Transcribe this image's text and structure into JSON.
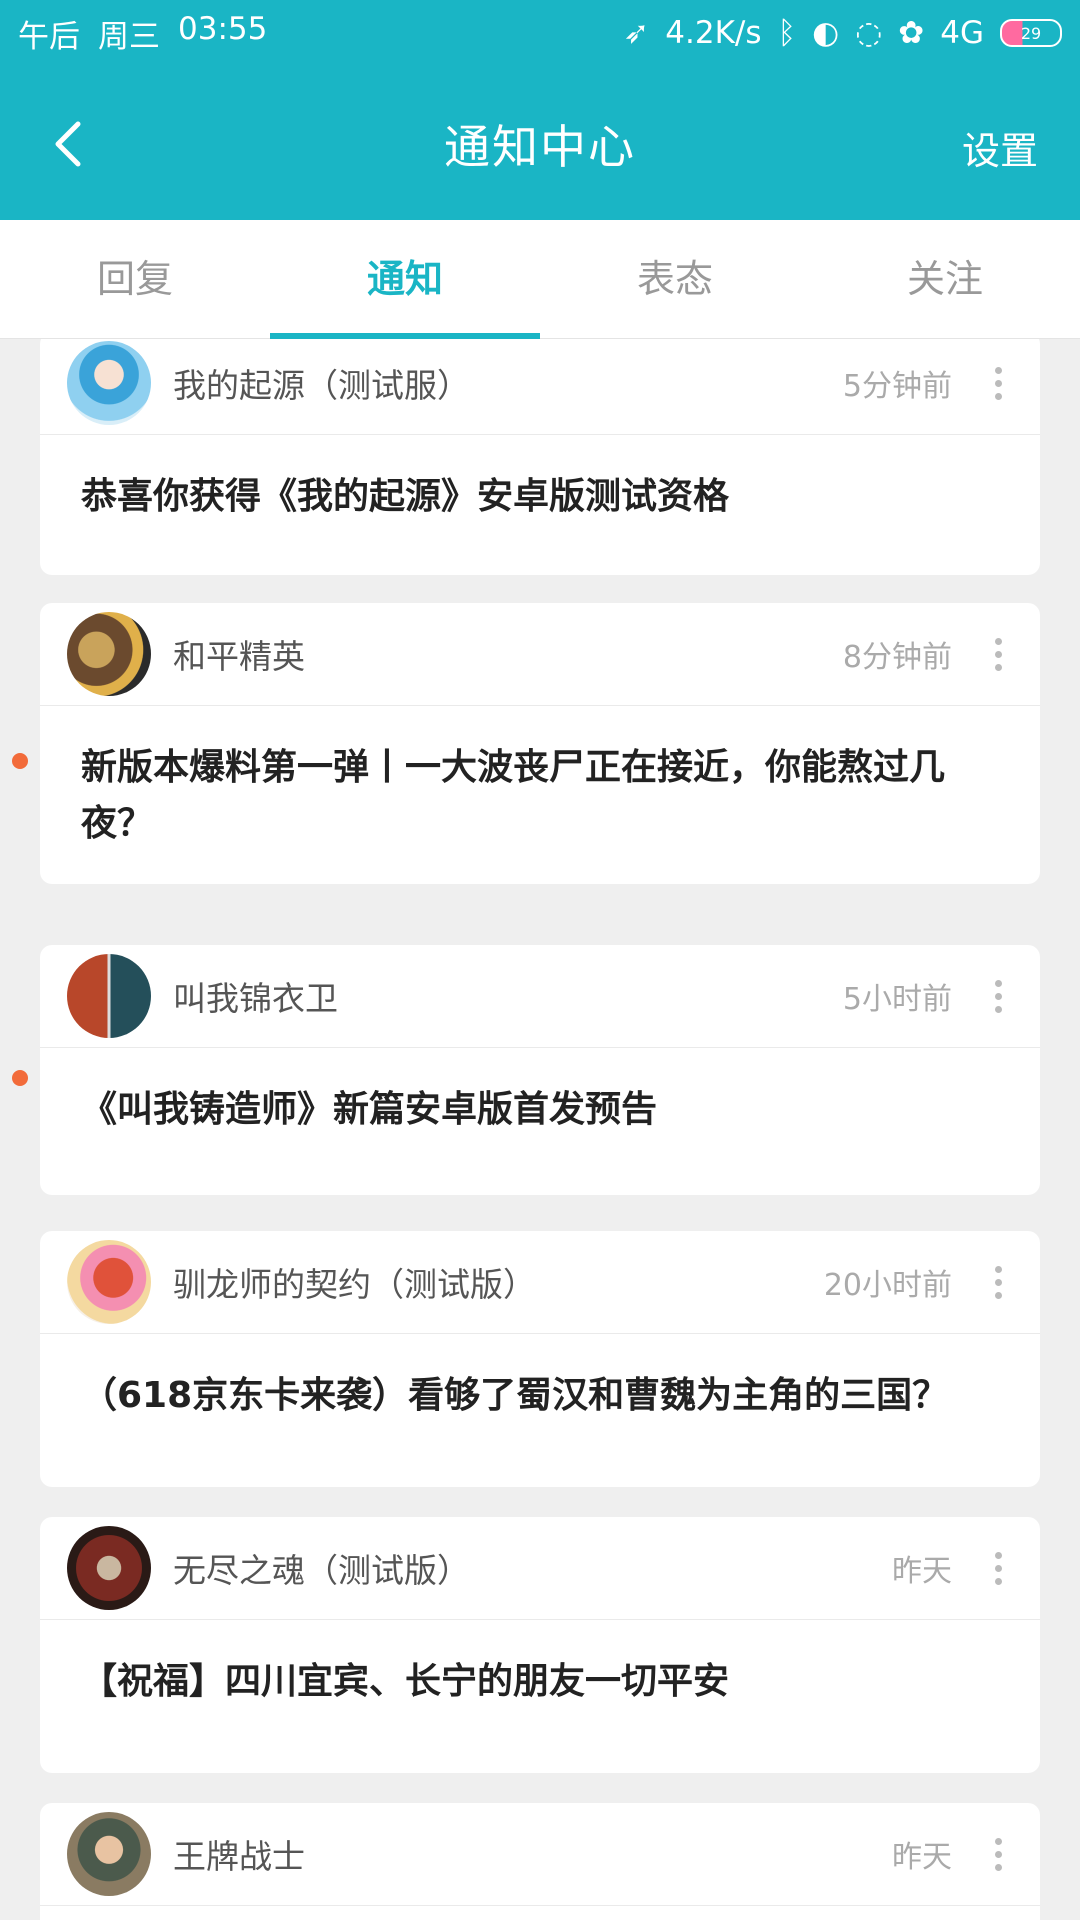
{
  "status_bar": {
    "time_period": "午后",
    "weekday": "周三",
    "time": "03:55",
    "network_speed": "4.2K/s",
    "network_type": "4G",
    "battery": "29"
  },
  "app_bar": {
    "title": "通知中心",
    "settings_label": "设置"
  },
  "tabs": [
    {
      "label": "回复",
      "active": false
    },
    {
      "label": "通知",
      "active": true
    },
    {
      "label": "表态",
      "active": false
    },
    {
      "label": "关注",
      "active": false
    }
  ],
  "notifications": [
    {
      "source": "我的起源（测试服）",
      "time": "5分钟前",
      "message": "恭喜你获得《我的起源》安卓版测试资格",
      "unread": false
    },
    {
      "source": "和平精英",
      "time": "8分钟前",
      "message": "新版本爆料第一弹丨一大波丧尸正在接近，你能熬过几夜？",
      "unread": true
    },
    {
      "source": "叫我锦衣卫",
      "time": "5小时前",
      "message": "《叫我铸造师》新篇安卓版首发预告",
      "unread": true
    },
    {
      "source": "驯龙师的契约（测试版）",
      "time": "20小时前",
      "message": "（618京东卡来袭）看够了蜀汉和曹魏为主角的三国？",
      "unread": false
    },
    {
      "source": "无尽之魂（测试版）",
      "time": "昨天",
      "message": "【祝福】四川宜宾、长宁的朋友一切平安",
      "unread": false
    },
    {
      "source": "王牌战士",
      "time": "昨天",
      "message": "",
      "unread": false
    }
  ],
  "colors": {
    "accent": "#1ab5c5",
    "unread_dot": "#f26b3a",
    "background": "#efefef"
  }
}
